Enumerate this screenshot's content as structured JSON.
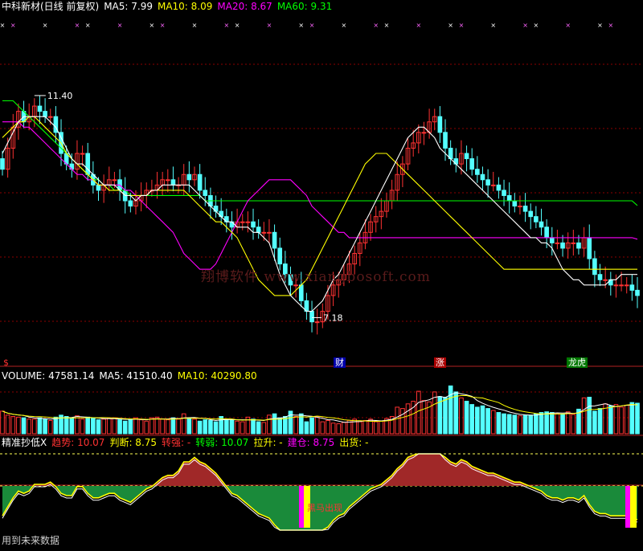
{
  "colors": {
    "up": "#ff3232",
    "down": "#54ffff",
    "ma5": "#ffffff",
    "ma10": "#ffff00",
    "ma20": "#ff00ff",
    "ma60": "#00ff00",
    "grid": "#8b0000",
    "trend_up": "#ff3232",
    "hump": "#a02828",
    "zone": "#1a8a3a",
    "dash": "#ffff55"
  },
  "main_header": {
    "title": "中科新材(日线 前复权)",
    "ma5": "MA5: 7.99",
    "ma10": "MA10: 8.09",
    "ma20": "MA20: 8.67",
    "ma60": "MA60: 9.31"
  },
  "main_labels": {
    "high": "11.40",
    "low": "7.18",
    "marker_left": "$",
    "tag_cai": "财",
    "tag_zhang": "涨",
    "tag_longhu": "龙虎"
  },
  "watermark": "翔博软件 www.xiangbosoft.com",
  "volume_header": {
    "volume": "VOLUME: 47581.14",
    "ma5": "MA5: 41510.40",
    "ma10": "MA10: 40290.80"
  },
  "indicator_header": {
    "name": "精准抄低X",
    "trend": "趋势: 10.07",
    "judge": "判断: 8.75",
    "strong": "转强: -",
    "weak": "转弱: 10.07",
    "rise": "拉升: -",
    "build": "建仓: 8.75",
    "sell": "出货: -"
  },
  "indicator_tag": "黑马出现",
  "footer": "用到未来数据",
  "chart_data": [
    {
      "type": "candlestick",
      "title": "中科新材(日线 前复权)",
      "ylim": [
        6.5,
        12.3
      ],
      "annotations": [
        {
          "label": "11.40",
          "kind": "high"
        },
        {
          "label": "7.18",
          "kind": "low"
        }
      ],
      "series": [
        {
          "name": "MA5",
          "last": 7.99
        },
        {
          "name": "MA10",
          "last": 8.09
        },
        {
          "name": "MA20",
          "last": 8.67
        },
        {
          "name": "MA60",
          "last": 9.31
        }
      ],
      "close": [
        10.0,
        10.4,
        10.8,
        11.1,
        10.9,
        11.0,
        11.2,
        11.1,
        11.0,
        11.0,
        10.7,
        10.3,
        10.1,
        10.0,
        10.3,
        10.3,
        9.9,
        9.7,
        9.6,
        9.7,
        9.8,
        9.8,
        9.6,
        9.4,
        9.3,
        9.4,
        9.5,
        9.6,
        9.6,
        9.7,
        9.8,
        9.8,
        9.7,
        9.7,
        9.9,
        9.8,
        9.9,
        9.6,
        9.5,
        9.3,
        9.2,
        9.1,
        9.0,
        8.9,
        9.0,
        9.0,
        9.0,
        8.9,
        8.8,
        8.8,
        8.8,
        8.5,
        8.2,
        8.0,
        7.8,
        7.8,
        7.5,
        7.3,
        7.1,
        7.1,
        7.3,
        7.6,
        7.8,
        7.9,
        8.0,
        8.2,
        8.4,
        8.6,
        8.8,
        9.0,
        9.1,
        9.2,
        9.4,
        9.6,
        9.9,
        10.1,
        10.4,
        10.5,
        10.7,
        10.7,
        10.9,
        11.0,
        10.7,
        10.4,
        10.2,
        10.1,
        10.3,
        10.2,
        10.0,
        9.9,
        9.8,
        9.7,
        9.7,
        9.6,
        9.5,
        9.4,
        9.3,
        9.3,
        9.2,
        9.1,
        9.0,
        8.9,
        8.7,
        8.6,
        8.6,
        8.5,
        8.6,
        8.6,
        8.5,
        8.7,
        8.3,
        8.0,
        7.9,
        7.9,
        7.8,
        7.8,
        7.8,
        7.8,
        7.7,
        7.6
      ],
      "ma5": [
        10.3,
        10.5,
        10.7,
        10.9,
        11.0,
        11.0,
        11.0,
        11.0,
        11.0,
        10.9,
        10.8,
        10.6,
        10.4,
        10.2,
        10.1,
        10.1,
        10.0,
        9.9,
        9.8,
        9.7,
        9.7,
        9.7,
        9.6,
        9.5,
        9.5,
        9.4,
        9.5,
        9.5,
        9.6,
        9.6,
        9.7,
        9.7,
        9.7,
        9.7,
        9.7,
        9.7,
        9.6,
        9.5,
        9.4,
        9.3,
        9.2,
        9.1,
        9.0,
        9.0,
        8.9,
        8.9,
        8.9,
        8.8,
        8.8,
        8.7,
        8.6,
        8.3,
        8.0,
        7.8,
        7.6,
        7.5,
        7.4,
        7.3,
        7.3,
        7.4,
        7.5,
        7.7,
        7.9,
        8.0,
        8.2,
        8.4,
        8.6,
        8.8,
        9.0,
        9.2,
        9.4,
        9.6,
        9.8,
        10.0,
        10.2,
        10.4,
        10.6,
        10.7,
        10.8,
        10.8,
        10.7,
        10.6,
        10.4,
        10.3,
        10.2,
        10.1,
        10.0,
        9.9,
        9.8,
        9.7,
        9.6,
        9.5,
        9.4,
        9.3,
        9.2,
        9.1,
        9.0,
        8.9,
        8.8,
        8.7,
        8.7,
        8.6,
        8.6,
        8.5,
        8.3,
        8.1,
        8.0,
        7.9,
        7.9,
        7.8,
        7.8,
        7.8,
        7.8,
        7.8,
        7.9,
        7.9,
        8.0,
        8.0,
        8.0,
        8.0
      ],
      "ma10": [
        10.6,
        10.7,
        10.8,
        10.9,
        10.9,
        11.0,
        11.0,
        10.9,
        10.8,
        10.7,
        10.6,
        10.5,
        10.3,
        10.2,
        10.1,
        10.0,
        9.9,
        9.8,
        9.7,
        9.7,
        9.6,
        9.6,
        9.6,
        9.5,
        9.5,
        9.5,
        9.5,
        9.5,
        9.6,
        9.6,
        9.6,
        9.6,
        9.6,
        9.6,
        9.6,
        9.5,
        9.4,
        9.3,
        9.2,
        9.1,
        9.0,
        9.0,
        8.9,
        8.8,
        8.7,
        8.5,
        8.3,
        8.1,
        7.9,
        7.8,
        7.7,
        7.6,
        7.6,
        7.6,
        7.6,
        7.7,
        7.8,
        7.9,
        8.1,
        8.3,
        8.5,
        8.7,
        8.9,
        9.1,
        9.3,
        9.5,
        9.7,
        9.9,
        10.1,
        10.2,
        10.3,
        10.3,
        10.3,
        10.2,
        10.1,
        10.0,
        9.9,
        9.8,
        9.7,
        9.6,
        9.5,
        9.4,
        9.3,
        9.2,
        9.1,
        9.0,
        8.9,
        8.8,
        8.7,
        8.6,
        8.5,
        8.4,
        8.3,
        8.2,
        8.1,
        8.1,
        8.1,
        8.1,
        8.1,
        8.1,
        8.1,
        8.1,
        8.1,
        8.1,
        8.1,
        8.1,
        8.1,
        8.1,
        8.1,
        8.1,
        8.1,
        8.1,
        8.1,
        8.1,
        8.1,
        8.1,
        8.1,
        8.1,
        8.1,
        8.1
      ],
      "ma20": [
        10.9,
        10.9,
        10.9,
        10.9,
        10.8,
        10.8,
        10.7,
        10.6,
        10.5,
        10.4,
        10.3,
        10.2,
        10.1,
        10.0,
        9.9,
        9.9,
        9.8,
        9.8,
        9.7,
        9.7,
        9.7,
        9.7,
        9.7,
        9.6,
        9.6,
        9.5,
        9.4,
        9.3,
        9.2,
        9.1,
        9.0,
        8.9,
        8.8,
        8.6,
        8.4,
        8.3,
        8.2,
        8.1,
        8.1,
        8.1,
        8.2,
        8.4,
        8.6,
        8.8,
        9.0,
        9.2,
        9.4,
        9.5,
        9.6,
        9.7,
        9.8,
        9.8,
        9.8,
        9.8,
        9.8,
        9.7,
        9.6,
        9.5,
        9.3,
        9.2,
        9.1,
        9.0,
        8.9,
        8.8,
        8.8,
        8.7,
        8.7,
        8.7,
        8.7,
        8.7,
        8.7,
        8.7,
        8.7,
        8.7,
        8.7,
        8.7,
        8.7,
        8.7,
        8.7,
        8.7,
        8.7,
        8.7,
        8.7,
        8.7,
        8.7,
        8.7,
        8.7,
        8.7,
        8.7,
        8.7,
        8.7,
        8.7,
        8.7,
        8.7,
        8.7,
        8.7,
        8.7,
        8.7,
        8.7,
        8.7,
        8.7,
        8.7,
        8.7,
        8.7,
        8.7,
        8.7,
        8.7,
        8.7,
        8.7,
        8.7,
        8.7,
        8.7,
        8.7,
        8.7,
        8.7,
        8.7,
        8.7,
        8.7,
        8.7,
        8.67
      ],
      "ma60": [
        11.3,
        11.3,
        11.3,
        11.2,
        11.1,
        11.0,
        10.9,
        10.8,
        10.7,
        10.6,
        10.5,
        10.4,
        10.3,
        10.2,
        10.1,
        10.0,
        9.9,
        9.8,
        9.8,
        9.7,
        9.7,
        9.6,
        9.6,
        9.6,
        9.5,
        9.5,
        9.5,
        9.5,
        9.5,
        9.5,
        9.5,
        9.5,
        9.5,
        9.5,
        9.5,
        9.5,
        9.5,
        9.5,
        9.4,
        9.4,
        9.4,
        9.4,
        9.4,
        9.4,
        9.4,
        9.4,
        9.4,
        9.4,
        9.4,
        9.4,
        9.4,
        9.4,
        9.4,
        9.4,
        9.4,
        9.4,
        9.4,
        9.4,
        9.4,
        9.4,
        9.4,
        9.4,
        9.4,
        9.4,
        9.4,
        9.4,
        9.4,
        9.4,
        9.4,
        9.4,
        9.4,
        9.4,
        9.4,
        9.4,
        9.4,
        9.4,
        9.4,
        9.4,
        9.4,
        9.4,
        9.4,
        9.4,
        9.4,
        9.4,
        9.4,
        9.4,
        9.4,
        9.4,
        9.4,
        9.4,
        9.4,
        9.4,
        9.4,
        9.4,
        9.4,
        9.4,
        9.4,
        9.4,
        9.4,
        9.4,
        9.4,
        9.4,
        9.4,
        9.4,
        9.4,
        9.4,
        9.4,
        9.4,
        9.4,
        9.4,
        9.4,
        9.4,
        9.4,
        9.4,
        9.4,
        9.4,
        9.4,
        9.4,
        9.4,
        9.31
      ]
    },
    {
      "type": "bar",
      "title": "VOLUME",
      "series": [
        {
          "name": "VOLUME",
          "last": 47581.14
        },
        {
          "name": "MA5",
          "last": 41510.4
        },
        {
          "name": "MA10",
          "last": 40290.8
        }
      ],
      "values": [
        34,
        28,
        26,
        25,
        24,
        22,
        22,
        24,
        22,
        20,
        25,
        28,
        26,
        24,
        27,
        22,
        25,
        23,
        21,
        22,
        23,
        24,
        21,
        19,
        22,
        24,
        21,
        19,
        24,
        25,
        22,
        21,
        24,
        22,
        30,
        24,
        22,
        19,
        21,
        20,
        18,
        26,
        22,
        20,
        19,
        18,
        25,
        22,
        18,
        17,
        28,
        30,
        24,
        26,
        34,
        26,
        30,
        18,
        24,
        26,
        18,
        20,
        16,
        15,
        17,
        20,
        22,
        18,
        20,
        22,
        18,
        19,
        23,
        26,
        40,
        38,
        45,
        49,
        64,
        50,
        48,
        63,
        56,
        55,
        72,
        63,
        54,
        49,
        44,
        40,
        42,
        38,
        35,
        32,
        30,
        29,
        28,
        27,
        28,
        28,
        30,
        32,
        33,
        32,
        30,
        29,
        33,
        29,
        37,
        54,
        55,
        34,
        38,
        45,
        42,
        44,
        40,
        43,
        47,
        46
      ]
    },
    {
      "type": "area",
      "title": "精准抄低X",
      "series": [
        {
          "name": "白线"
        },
        {
          "name": "黄线"
        }
      ]
    }
  ]
}
